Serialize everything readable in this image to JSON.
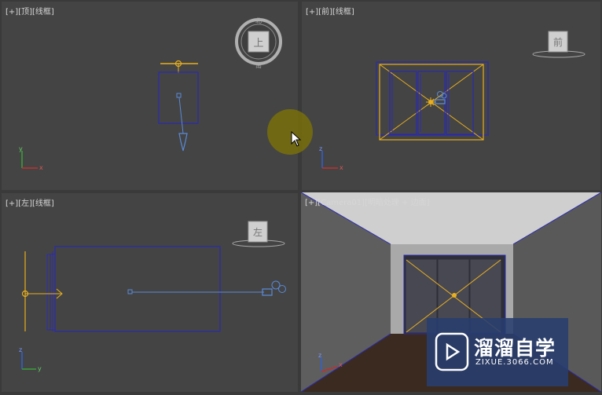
{
  "viewports": {
    "top": {
      "prefix": "[+]",
      "view": "[顶]",
      "mode": "[线框]",
      "cube_label": "上"
    },
    "front": {
      "prefix": "[+]",
      "view": "[前]",
      "mode": "[线框]",
      "cube_label": "前"
    },
    "left": {
      "prefix": "[+]",
      "view": "[左]",
      "mode": "[线框]",
      "cube_label": "左"
    },
    "camera": {
      "prefix": "[+]",
      "view": "[Camera01]",
      "mode": "[明暗处理 + 边面]"
    }
  },
  "axis": {
    "x": "x",
    "y": "y",
    "z": "z"
  },
  "watermark": {
    "title": "溜溜自学",
    "subtitle": "ZIXUE.3066.COM"
  },
  "colors": {
    "selection": "#e8b020",
    "wire": "#2b2bb0",
    "helper": "#5a8ad8",
    "active_border": "#c8a040",
    "viewport_bg": "#444444"
  }
}
